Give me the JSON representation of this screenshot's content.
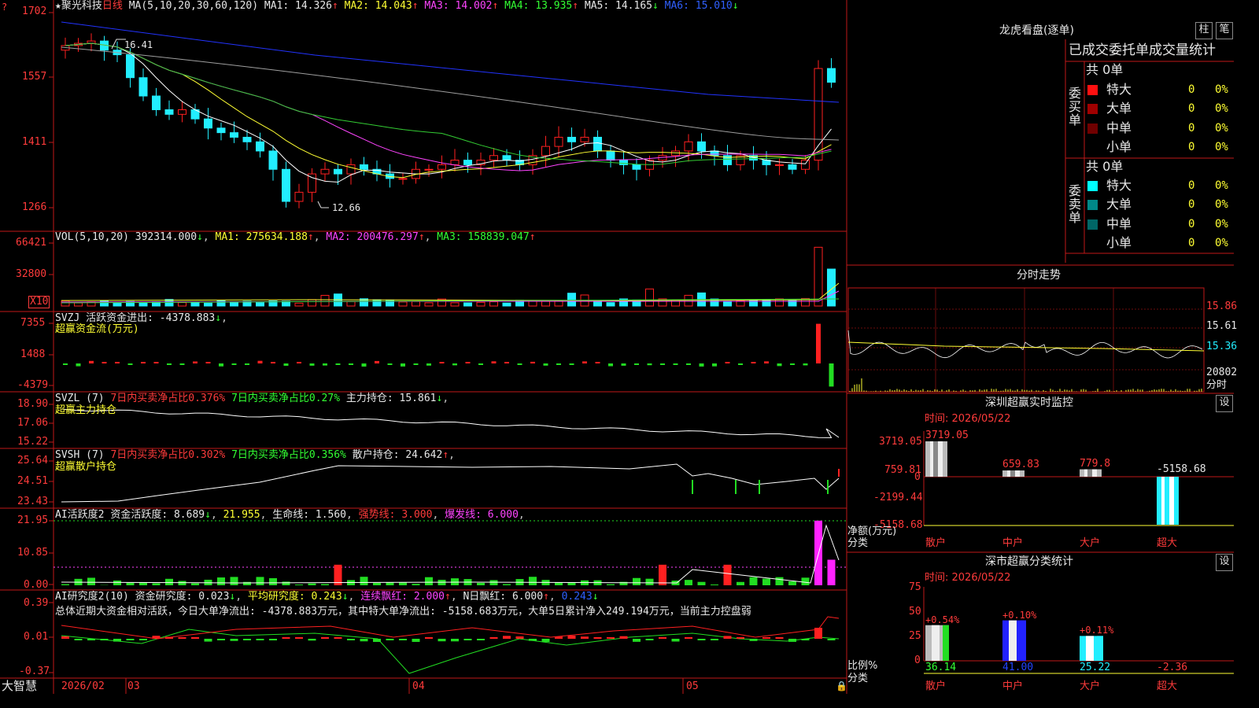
{
  "colors": {
    "up": "#ff2020",
    "down": "#22eeff",
    "border": "#c01818",
    "grid": "#7a1010",
    "ma1": "#ffffff",
    "ma2": "#ffff33",
    "ma3": "#ff44ff",
    "ma4": "#33cc33",
    "ma5": "#aaaaaa",
    "ma6": "#2233ff"
  },
  "price_panel": {
    "star": "★",
    "name": "聚光科技",
    "period": "日线",
    "ma_params": "MA(5,10,20,30,60,120)",
    "mas": [
      {
        "label": "MA1: 14.326",
        "arrow": "↑"
      },
      {
        "label": "MA2: 14.043",
        "arrow": "↑"
      },
      {
        "label": "MA3: 14.002",
        "arrow": "↑"
      },
      {
        "label": "MA4: 13.935",
        "arrow": "↑"
      },
      {
        "label": "MA5: 14.165",
        "arrow": "↓"
      },
      {
        "label": "MA6: 15.010",
        "arrow": "↓"
      }
    ],
    "y_ticks": [
      "1702",
      "1557",
      "1411",
      "1266"
    ],
    "high_marker": "16.41",
    "low_marker": "12.66"
  },
  "vol_panel": {
    "title": "VOL(5,10,20)",
    "value": "392314.000",
    "value_arrow": "↓",
    "ma1": "MA1: 275634.188",
    "ma1_arrow": "↑",
    "ma2": "MA2: 200476.297",
    "ma2_arrow": "↑",
    "ma3": "MA3: 158839.047",
    "ma3_arrow": "↑",
    "y_ticks": [
      "66421",
      "32800"
    ],
    "unit": "X10"
  },
  "svzj_panel": {
    "title": "SVZJ",
    "label": "活跃资金进出: -4378.883",
    "arrow": "↓",
    "subtitle": "超赢资金流(万元)",
    "y_ticks": [
      "7355",
      "1488",
      "-4379"
    ]
  },
  "svzl_panel": {
    "title": "SVZL (7)",
    "a": "7日内买卖净占比0.376%",
    "b": "7日内买卖净占比0.27%",
    "c": "主力持仓: 15.861",
    "c_arrow": "↓",
    "subtitle": "超赢主力持仓",
    "y_ticks": [
      "18.90",
      "17.06",
      "15.22"
    ]
  },
  "svsh_panel": {
    "title": "SVSH (7)",
    "a": "7日内买卖净占比0.302%",
    "b": "7日内买卖净占比0.356%",
    "c": "散户持仓: 24.642",
    "c_arrow": "↑",
    "subtitle": "超赢散户持仓",
    "y_ticks": [
      "25.64",
      "24.51",
      "23.43"
    ]
  },
  "ai1_panel": {
    "title": "AI活跃度2",
    "l1": "资金活跃度: 8.689",
    "l1_arrow": "↓",
    "l2": "21.955",
    "l3": "生命线: 1.560",
    "l4": "强势线: 3.000",
    "l5": "爆发线: 6.000",
    "y_ticks": [
      "21.95",
      "10.85",
      "0.00"
    ]
  },
  "ai2_panel": {
    "title": "AI研究度2(10)",
    "l1": "资金研究度: 0.023",
    "l1_arrow": "↓",
    "l2": "平均研究度: 0.243",
    "l2_arrow": "↓",
    "l3": "连续飘红: 2.000",
    "l3_arrow": "↑",
    "l4": "N日飘红: 6.000",
    "l4_arrow": "↑",
    "l5": "0.243",
    "l5_arrow": "↓",
    "summary": "总体近期大资金相对活跃，今日大单净流出: -4378.883万元，其中特大单净流出: -5158.683万元，大单5日累计净入249.194万元，当前主力控盘弱",
    "y_ticks": [
      "0.39",
      "0.01",
      "-0.37"
    ]
  },
  "time_axis": {
    "brand": "大智慧",
    "labels": [
      "2026/02",
      "03",
      "04",
      "05"
    ]
  },
  "dragon": {
    "title": "龙虎看盘(逐单)",
    "btn_col": "柱",
    "btn_order": "笔",
    "header": "已成交委托单成交量统计",
    "buy": {
      "side": "委买单",
      "total": "共 0单",
      "rows": [
        {
          "label": "特大",
          "count": "0",
          "pct": "0%"
        },
        {
          "label": "大单",
          "count": "0",
          "pct": "0%"
        },
        {
          "label": "中单",
          "count": "0",
          "pct": "0%"
        },
        {
          "label": "小单",
          "count": "0",
          "pct": "0%"
        }
      ]
    },
    "sell": {
      "side": "委卖单",
      "total": "共 0单",
      "rows": [
        {
          "label": "特大",
          "count": "0",
          "pct": "0%"
        },
        {
          "label": "大单",
          "count": "0",
          "pct": "0%"
        },
        {
          "label": "中单",
          "count": "0",
          "pct": "0%"
        },
        {
          "label": "小单",
          "count": "0",
          "pct": "0%"
        }
      ]
    }
  },
  "intraday": {
    "title": "分时走势",
    "y_labels": [
      "15.86",
      "15.61",
      "15.36"
    ],
    "vol_label": "20802",
    "footer": "分时"
  },
  "sz_monitor": {
    "title": "深圳超赢实时监控",
    "settings": "设",
    "time": "时间: 2026/05/22",
    "y_ticks": [
      "3719.05",
      "759.81",
      "0",
      "-2199.44",
      "-5158.68"
    ],
    "ylabel": "净额(万元)",
    "xlabel": "分类",
    "categories": [
      "散户",
      "中户",
      "大户",
      "超大"
    ],
    "values": [
      3719.05,
      659.83,
      779.8,
      -5158.68
    ],
    "value_labels": [
      "3719.05",
      "659.83",
      "779.8",
      "-5158.68"
    ]
  },
  "sz_stats": {
    "title": "深市超赢分类统计",
    "settings": "设",
    "time": "时间: 2026/05/22",
    "y_ticks": [
      "75",
      "50",
      "25",
      "0"
    ],
    "ylabel": "比例%",
    "xlabel": "分类",
    "categories": [
      "散户",
      "中户",
      "大户",
      "超大"
    ],
    "values": [
      36.14,
      41.0,
      25.22,
      -2.36
    ],
    "value_labels": [
      "36.14",
      "41.00",
      "25.22",
      "-2.36"
    ],
    "changes": [
      "+0.54%",
      "+0.10%",
      "+0.11%",
      ""
    ]
  }
}
